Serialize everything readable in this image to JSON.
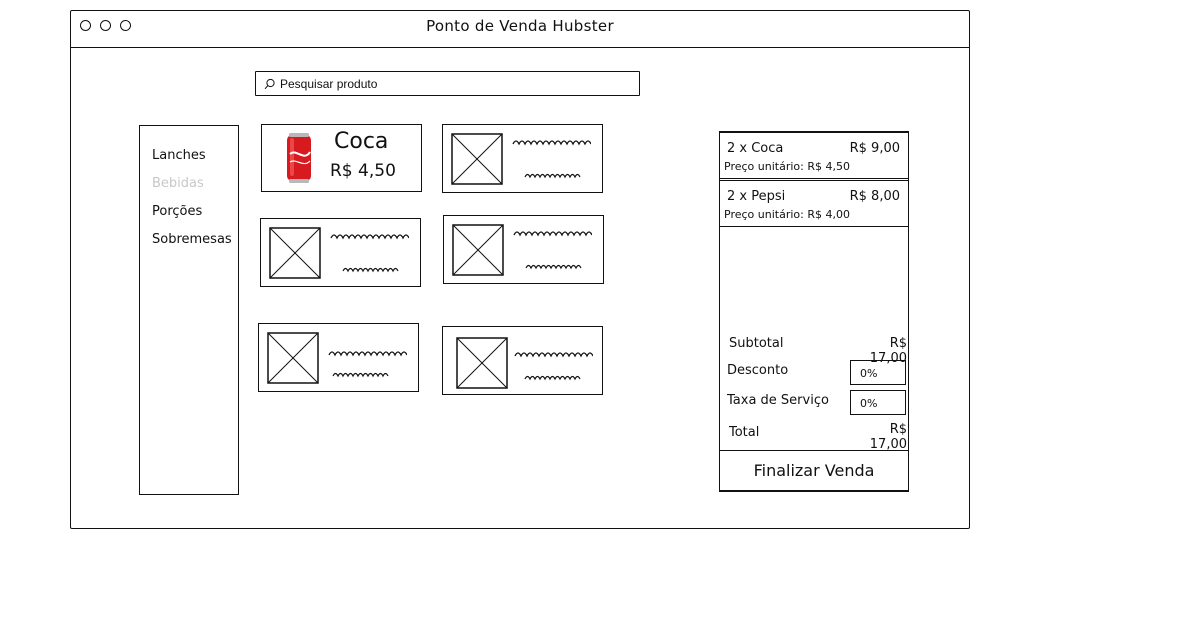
{
  "window": {
    "title": "Ponto de Venda Hubster"
  },
  "search": {
    "placeholder": "Pesquisar produto"
  },
  "categories": [
    {
      "label": "Lanches"
    },
    {
      "label": "Bebidas"
    },
    {
      "label": "Porções"
    },
    {
      "label": "Sobremesas"
    }
  ],
  "products": [
    {
      "name": "Coca",
      "price": "R$ 4,50",
      "icon": "coke-can-image"
    }
  ],
  "cart": {
    "items": [
      {
        "name": "2 x Coca",
        "total": "R$ 9,00",
        "unit_price": "Preço unitário: R$ 4,50"
      },
      {
        "name": "2 x Pepsi",
        "total": "R$ 8,00",
        "unit_price": "Preço unitário: R$ 4,00"
      }
    ],
    "subtotal_label": "Subtotal",
    "subtotal_value": "R$ 17,00",
    "discount_label": "Desconto",
    "discount_value": "0%",
    "service_label": "Taxa de Serviço",
    "service_value": "0%",
    "total_label": "Total",
    "total_value": "R$ 17,00",
    "finalize_label": "Finalizar Venda"
  },
  "colors": {
    "ink": "#111111",
    "disabled_text": "#c8c8c8",
    "can_red": "#d71920"
  }
}
